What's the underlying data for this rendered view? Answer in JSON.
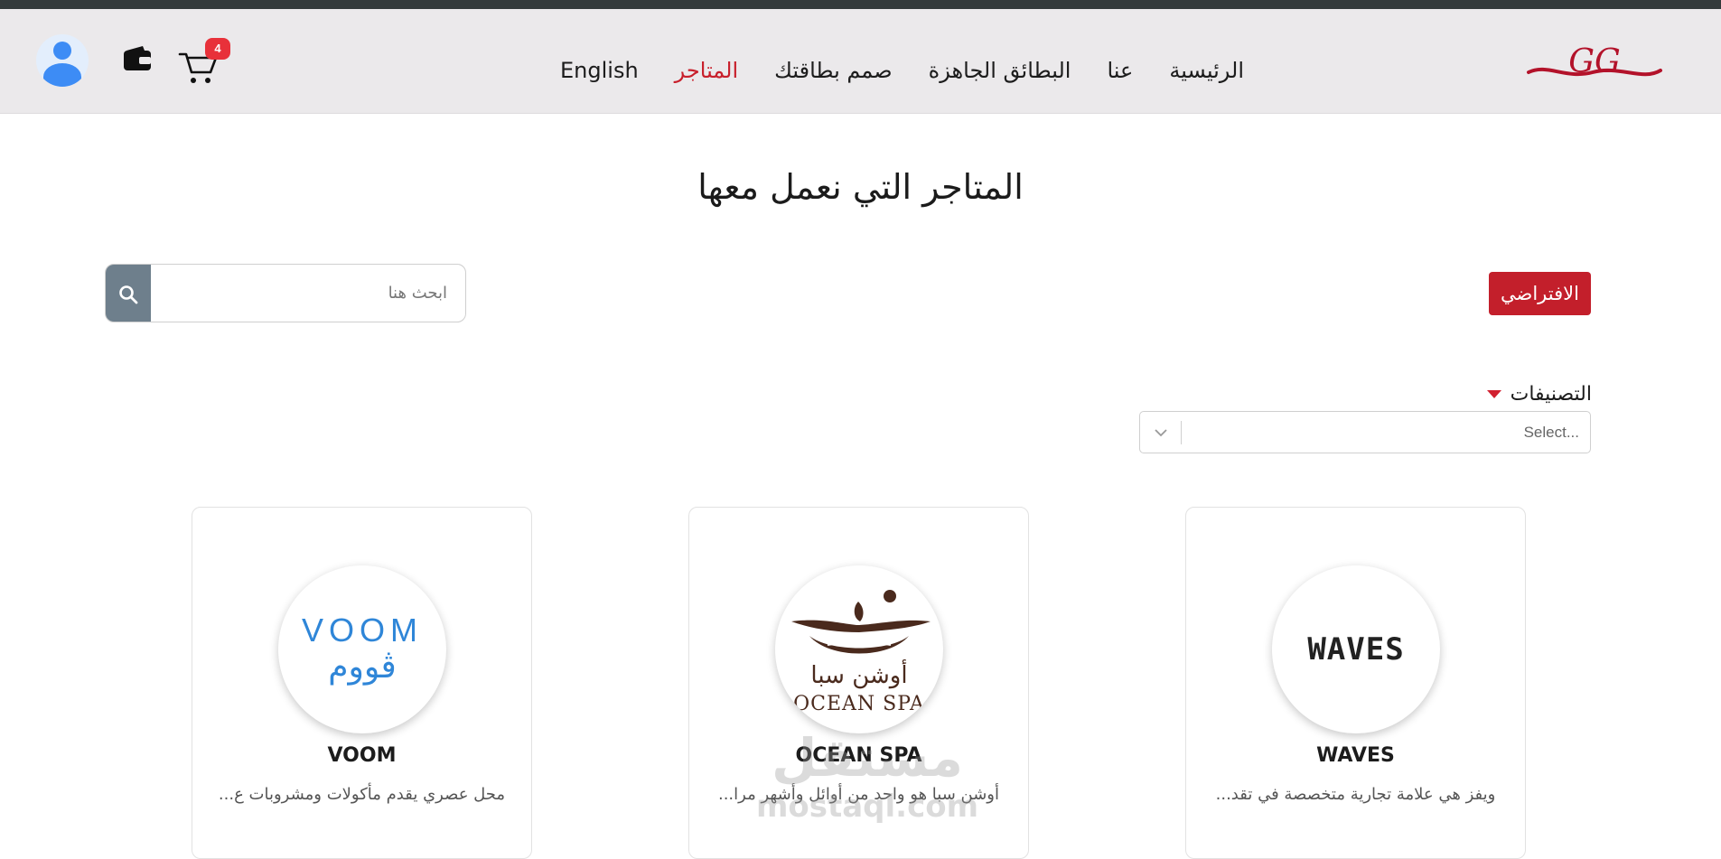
{
  "header": {
    "cart_count": "4",
    "nav": {
      "home": "الرئيسية",
      "about": "عنا",
      "ready_cards": "البطائق الجاهزة",
      "design_card": "صمم بطاقتك",
      "stores": "المتاجر",
      "language": "English"
    },
    "logo_text": "GG"
  },
  "main": {
    "title": "المتاجر التي نعمل معها",
    "search_placeholder": "ابحث هنا",
    "default_button": "الافتراضي",
    "categories_label": "التصنيفات",
    "select_placeholder": "Select..."
  },
  "stores": [
    {
      "name": "WAVES",
      "description": "ويفز هي علامة تجارية متخصصة في تقد...",
      "logo_text": "WAVES"
    },
    {
      "name": "OCEAN SPA",
      "description": "أوشن سبا هو واحد من أوائل وأشهر مرا...",
      "logo_text_ar": "أوشن سبا",
      "logo_text_en": "OCEAN SPA"
    },
    {
      "name": "VOOM",
      "description": "محل عصري يقدم مأكولات ومشروبات ع...",
      "logo_text_en": "VOOM",
      "logo_text_ar": "ڤووم"
    }
  ],
  "watermark": {
    "ar": "مستقل",
    "en": "mostaql.com"
  },
  "colors": {
    "accent": "#c81f2b",
    "header_bg": "#ebe9eb",
    "search_button": "#6e7f8c",
    "voom_blue": "#2f86d8",
    "ocean_brown": "#4a2a1d"
  },
  "icons": [
    "user-avatar-icon",
    "wallet-icon",
    "cart-icon",
    "search-icon",
    "chevron-down-icon",
    "caret-down-icon"
  ]
}
